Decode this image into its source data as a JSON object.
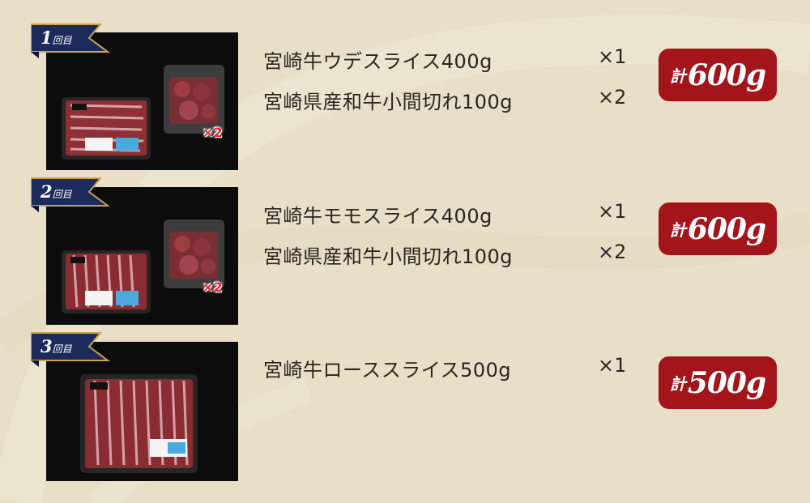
{
  "colors": {
    "background": "#e9dfc9",
    "ribbon": "#1c2a5c",
    "ribbon_border": "#c9a54a",
    "total_box": "#a4141b",
    "photo_bg": "#0c0c0c"
  },
  "shipments": [
    {
      "number": "1",
      "suffix": "回目",
      "photo_badge": "×2",
      "items": [
        {
          "name": "宮崎牛ウデスライス400g",
          "qty": "×1"
        },
        {
          "name": "宮崎県産和牛小間切れ100g",
          "qty": "×2"
        }
      ],
      "total_label": "計",
      "total_amount": "600g"
    },
    {
      "number": "2",
      "suffix": "回目",
      "photo_badge": "×2",
      "items": [
        {
          "name": "宮崎牛モモスライス400g",
          "qty": "×1"
        },
        {
          "name": "宮崎県産和牛小間切れ100g",
          "qty": "×2"
        }
      ],
      "total_label": "計",
      "total_amount": "600g"
    },
    {
      "number": "3",
      "suffix": "回目",
      "items": [
        {
          "name": "宮崎牛ローススライス500g",
          "qty": "×1"
        }
      ],
      "total_label": "計",
      "total_amount": "500g"
    }
  ]
}
